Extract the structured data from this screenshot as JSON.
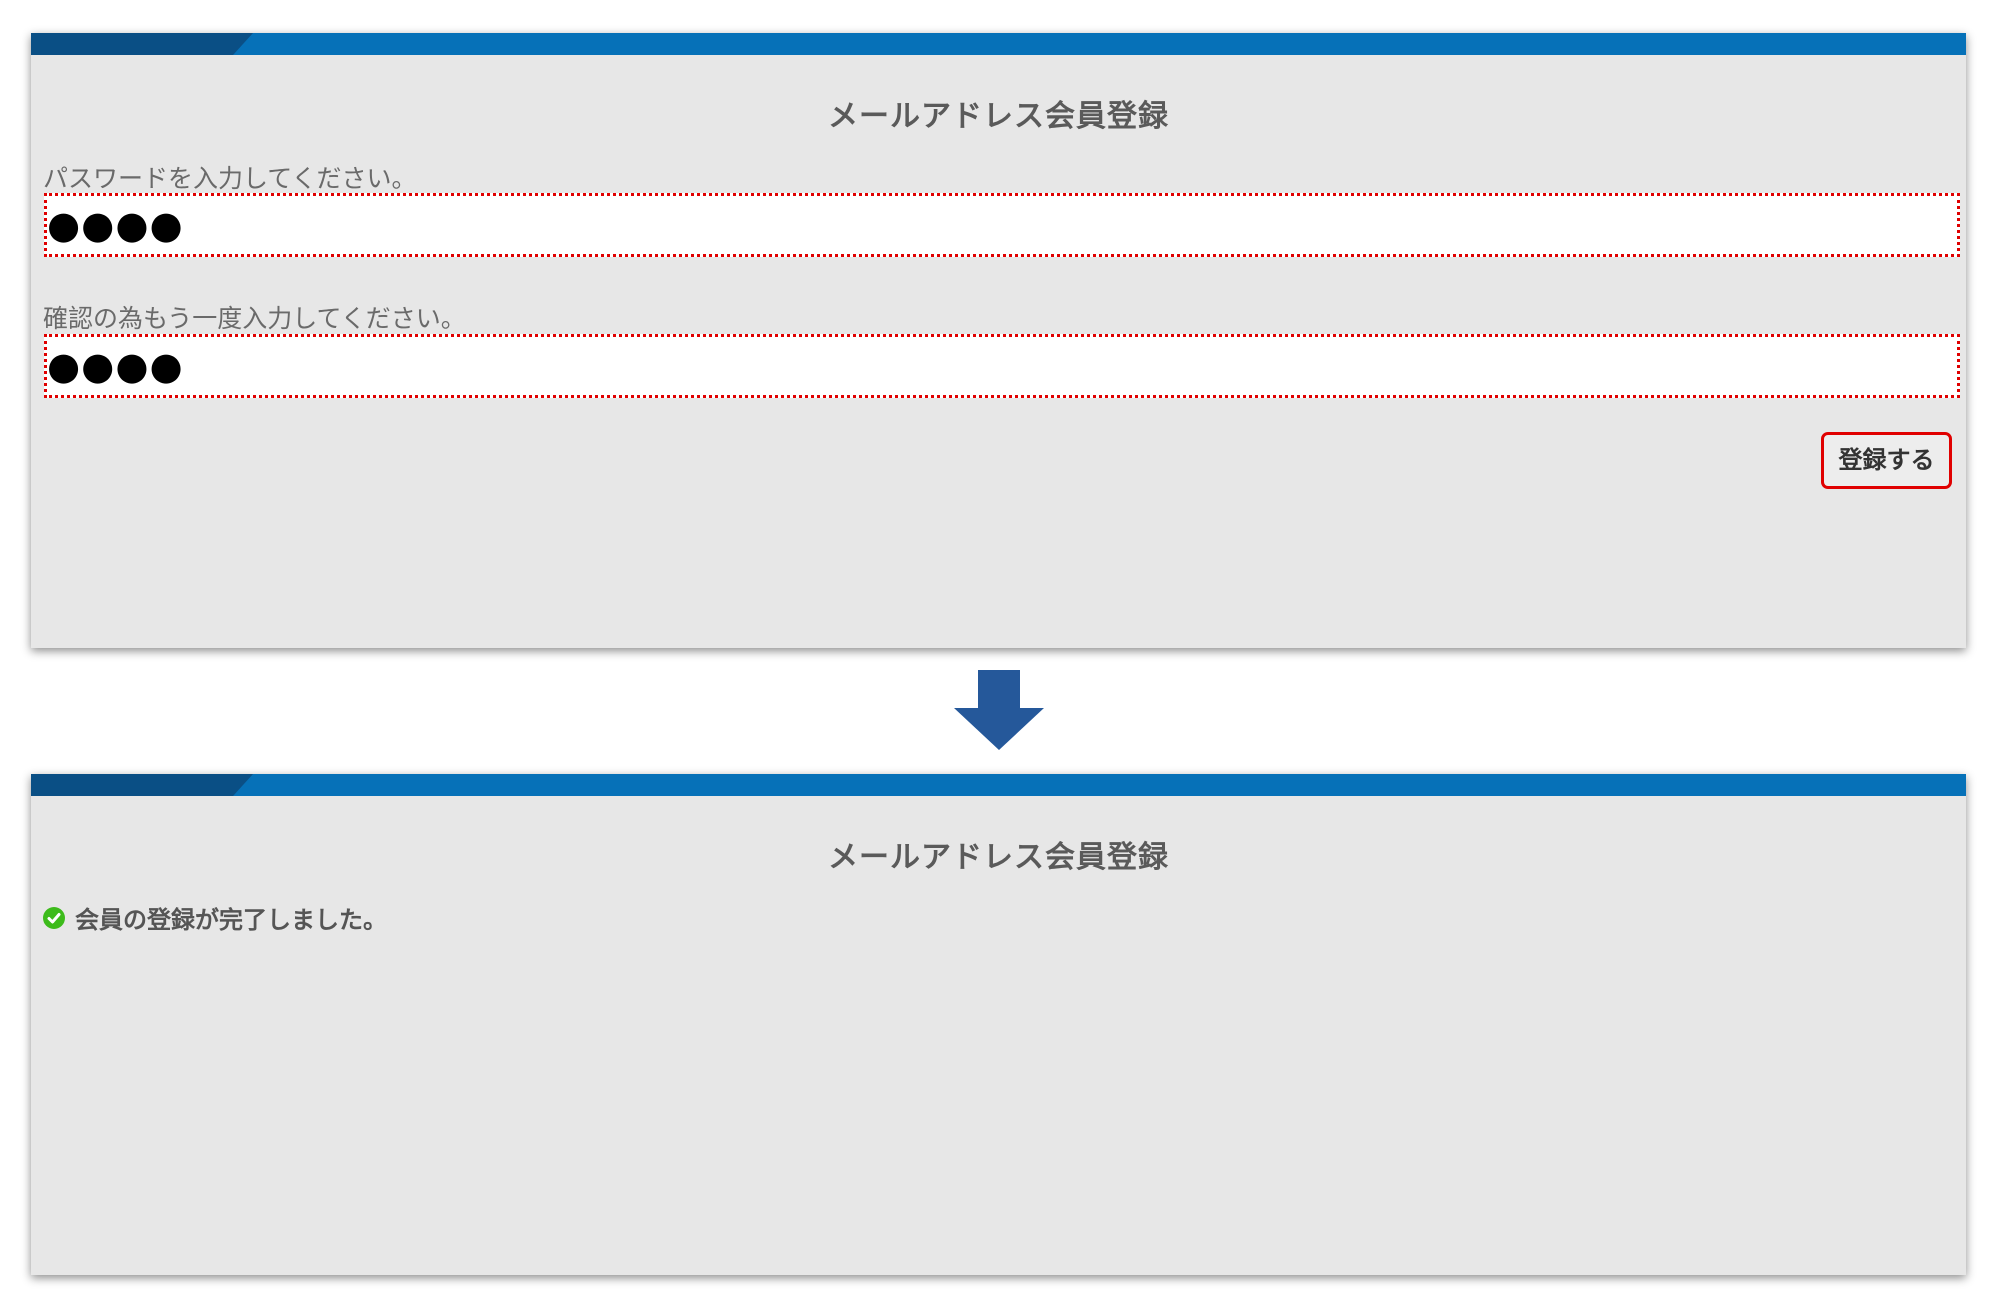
{
  "top_panel": {
    "title": "メールアドレス会員登録",
    "password_label": "パスワードを入力してください。",
    "password_value": "●●●●",
    "confirm_label": "確認の為もう一度入力してください。",
    "confirm_value": "●●●●",
    "register_button_label": "登録する"
  },
  "bottom_panel": {
    "title": "メールアドレス会員登録",
    "success_message": "会員の登録が完了しました。"
  },
  "colors": {
    "header_bar": "#0671b8",
    "header_accent": "#0a4f85",
    "arrow": "#25589a",
    "highlight": "#e00000",
    "success": "#3dbb1b"
  },
  "icons": {
    "transition": "arrow-down-icon",
    "success": "check-circle-icon"
  }
}
